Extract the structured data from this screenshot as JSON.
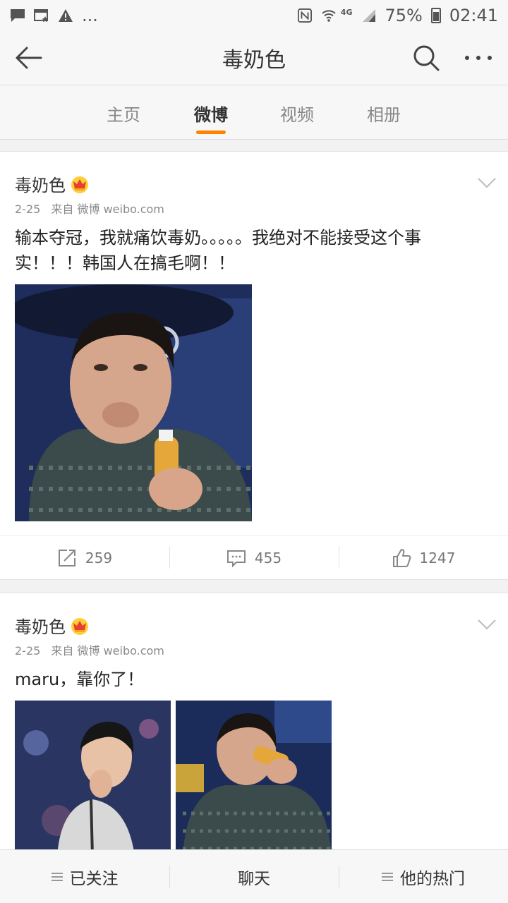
{
  "status_bar": {
    "overflow": "...",
    "network": "4G",
    "battery": "75%",
    "time": "02:41"
  },
  "nav": {
    "title": "毒奶色",
    "icons": [
      "back-arrow-icon",
      "search-icon",
      "more-icon"
    ]
  },
  "tabs": [
    {
      "label": "主页",
      "active": false
    },
    {
      "label": "微博",
      "active": true
    },
    {
      "label": "视频",
      "active": false
    },
    {
      "label": "相册",
      "active": false
    }
  ],
  "posts": [
    {
      "author": "毒奶色",
      "date": "2-25",
      "source": "来自 微博 weibo.com",
      "text_line1": "输本夺冠，我就痛饮毒奶。。。。。我绝对不能接受这个事",
      "text_line2": "实！！！韩国人在搞毛啊！！",
      "reposts": "259",
      "comments": "455",
      "likes": "1247"
    },
    {
      "author": "毒奶色",
      "date": "2-25",
      "source": "来自 微博 weibo.com",
      "text_line1": "maru，靠你了！"
    }
  ],
  "bottom_bar": {
    "follow": "已关注",
    "chat": "聊天",
    "hot": "他的热门"
  },
  "colors": {
    "accent": "#ff8200",
    "crown": "#f5a623",
    "background": "#f2f2f2"
  }
}
